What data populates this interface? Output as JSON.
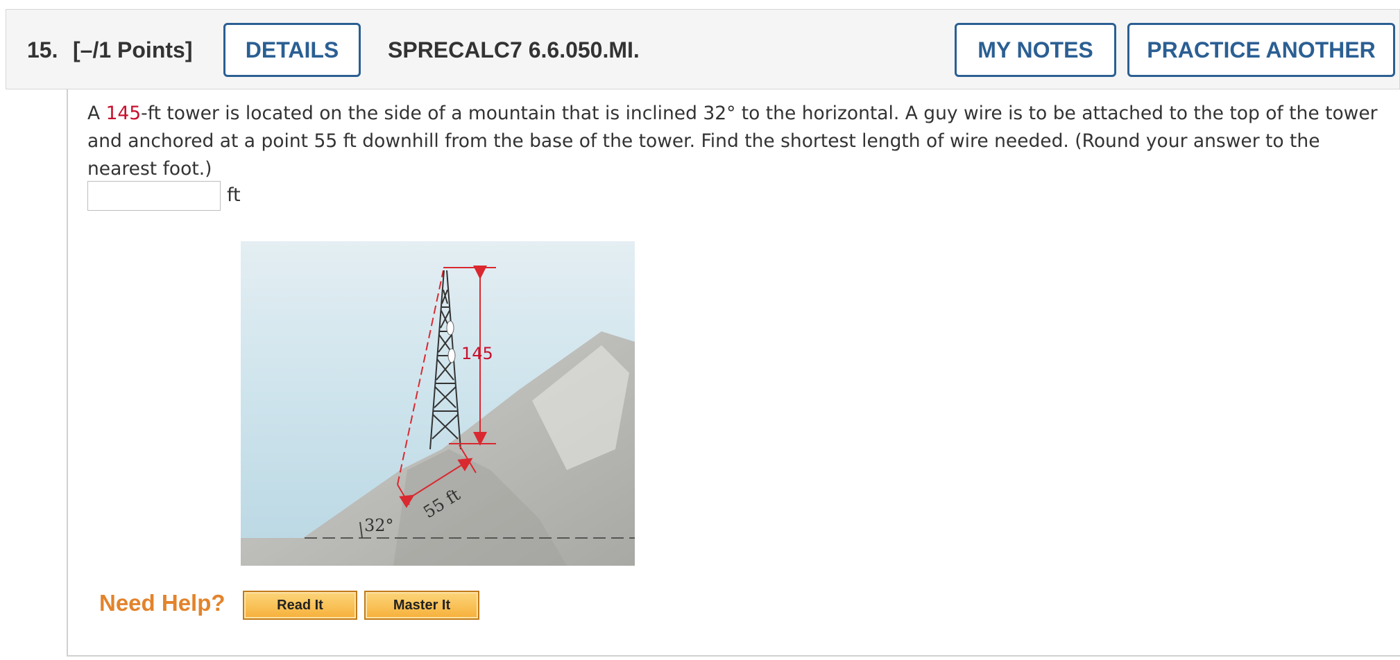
{
  "header": {
    "number": "15.",
    "points": "[–/1 Points]",
    "details_label": "DETAILS",
    "code": "SPRECALC7 6.6.050.MI.",
    "my_notes_label": "MY NOTES",
    "practice_label": "PRACTICE ANOTHER"
  },
  "question": {
    "text_before": "A ",
    "highlight": "145",
    "text_after": "-ft tower is located on the side of a mountain that is inclined 32° to the horizontal. A guy wire is to be attached to the top of the tower and anchored at a point 55 ft downhill from the base of the tower. Find the shortest length of wire needed. (Round your answer to the nearest foot.)",
    "answer_value": "",
    "unit": "ft"
  },
  "figure": {
    "height_label": "145",
    "distance_label": "55 ft",
    "angle_label": "32°"
  },
  "help": {
    "label": "Need Help?",
    "read_label": "Read It",
    "master_label": "Master It"
  },
  "colors": {
    "accent": "#2b5f93",
    "highlight": "#c8102e",
    "help": "#e3832b"
  }
}
